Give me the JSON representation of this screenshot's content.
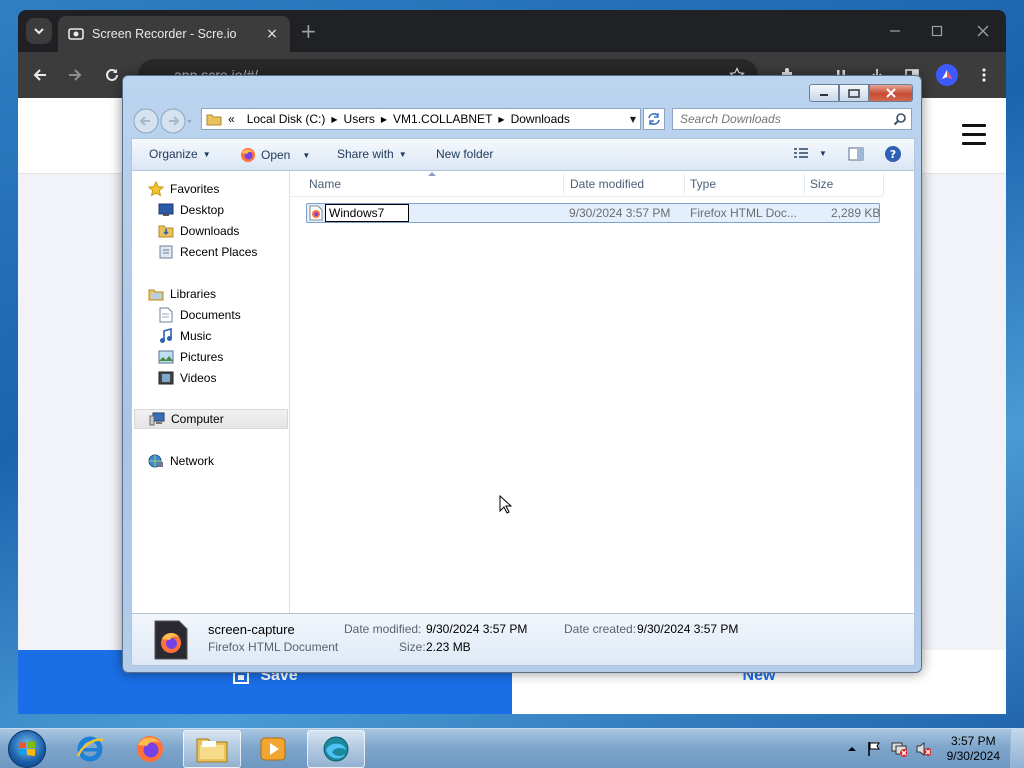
{
  "browser": {
    "tab_title": "Screen Recorder - Scre.io",
    "tab_close": "×",
    "new_tab": "+",
    "url": "app.scre.io/#/"
  },
  "webpage": {
    "save_label": "Save",
    "new_label": "New"
  },
  "dialog": {
    "breadcrumb": [
      "«",
      "Local Disk (C:)",
      "Users",
      "VM1.COLLABNET",
      "Downloads"
    ],
    "search_placeholder": "Search Downloads",
    "commands": {
      "organize": "Organize",
      "open": "Open",
      "share_with": "Share with",
      "new_folder": "New folder"
    },
    "nav": {
      "favorites": "Favorites",
      "desktop": "Desktop",
      "downloads": "Downloads",
      "recent_places": "Recent Places",
      "libraries": "Libraries",
      "documents": "Documents",
      "music": "Music",
      "pictures": "Pictures",
      "videos": "Videos",
      "computer": "Computer",
      "network": "Network"
    },
    "columns": {
      "name": "Name",
      "date_modified": "Date modified",
      "type": "Type",
      "size": "Size"
    },
    "file": {
      "name_edit": "Windows7",
      "date_modified": "9/30/2024 3:57 PM",
      "type": "Firefox HTML Doc...",
      "size": "2,289 KB"
    },
    "details": {
      "filename": "screen-capture",
      "filetype": "Firefox HTML Document",
      "date_modified_label": "Date modified:",
      "date_modified": "9/30/2024 3:57 PM",
      "date_created_label": "Date created:",
      "date_created": "9/30/2024 3:57 PM",
      "size_label": "Size:",
      "size": "2.23 MB"
    }
  },
  "taskbar": {
    "time": "3:57 PM",
    "date": "9/30/2024"
  },
  "colors": {
    "accent_blue": "#1a6fe6",
    "chrome_dark": "#202124",
    "dialog_frame": "#a9c5e6",
    "selected_row": "#e3effd"
  }
}
